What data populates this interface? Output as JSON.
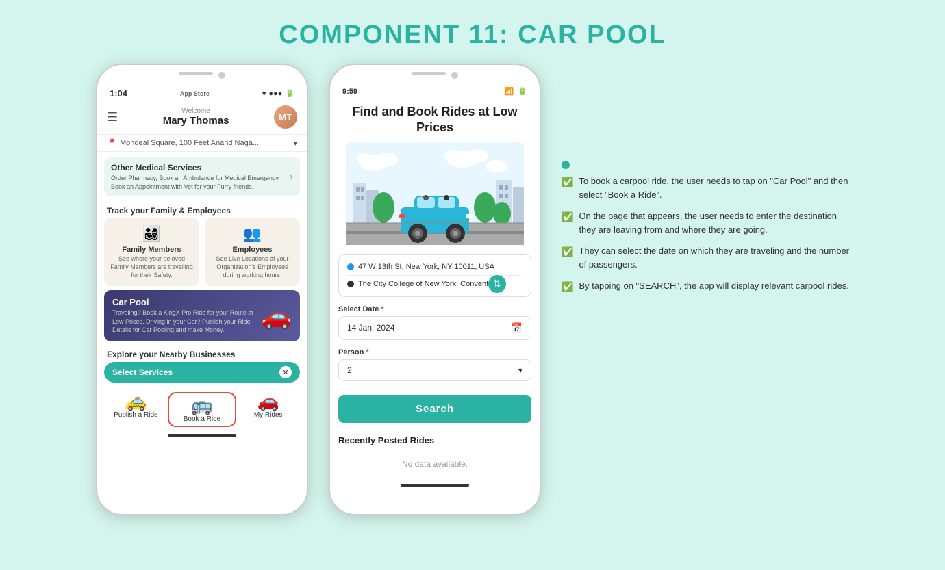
{
  "page": {
    "title": "COMPONENT 11: CAR POOL",
    "bg_color": "#d4f5ed"
  },
  "phone1": {
    "status": {
      "time": "1:04",
      "carrier": "App Store",
      "signal": "▶"
    },
    "header": {
      "welcome": "Welcome",
      "user_name": "Mary Thomas",
      "avatar_initials": "MT"
    },
    "location": "Mondeal Square, 100 Feet Anand Naga...",
    "medical_banner": {
      "title": "Other Medical Services",
      "desc": "Order Pharmacy, Book an Ambulance for Medical Emergency, Book an Appointment with Vet for your Furry friends."
    },
    "track_section": {
      "label": "Track your Family & Employees",
      "cards": [
        {
          "icon": "👨‍👩‍👧‍👦",
          "title": "Family Members",
          "desc": "See where your beloved Family Members are travelling for their Safety."
        },
        {
          "icon": "👥",
          "title": "Employees",
          "desc": "See Live Locations of your Organization's Employees during working hours."
        }
      ]
    },
    "carpool_banner": {
      "title": "Car Pool",
      "desc": "Traveling? Book a KingX Pro Ride for your Route at Low Prices.\nDriving in your Car?\nPublish your Ride Details for Car Pooling and make Money."
    },
    "nearby_label": "Explore your Nearby Businesses",
    "select_services_label": "Select Services",
    "bottom_icons": [
      {
        "icon": "🚕",
        "label": "Publish a Ride",
        "selected": false
      },
      {
        "icon": "🚌",
        "label": "Book a Ride",
        "selected": true
      },
      {
        "icon": "🚗",
        "label": "My Rides",
        "selected": false
      }
    ]
  },
  "phone2": {
    "status": {
      "time": "9:59",
      "wifi": "wifi",
      "battery": "battery"
    },
    "hero_text": "Find and Book Rides at\nLow Prices",
    "from_location": "47 W 13th St, New York, NY 10011, USA",
    "to_location": "The City College of New York, Convent Av...",
    "date_label": "Select Date",
    "date_required": true,
    "date_value": "14 Jan, 2024",
    "person_label": "Person",
    "person_required": true,
    "person_value": "2",
    "search_button": "Search",
    "recently_posted_title": "Recently Posted Rides",
    "no_data_text": "No data available."
  },
  "info_panel": {
    "items": [
      "To book a carpool ride, the user needs to tap on \"Car Pool\" and then select \"Book a Ride\".",
      "On the page that appears, the user needs to enter the destination they are leaving from and where they are going.",
      "They can select the date on which they are traveling and the number of passengers.",
      "By tapping on \"SEARCH\", the app will display relevant carpool rides."
    ]
  }
}
